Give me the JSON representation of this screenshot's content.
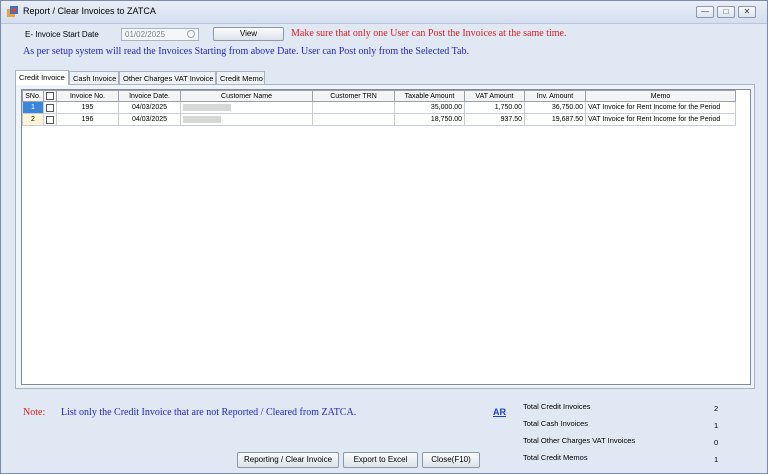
{
  "window": {
    "title": "Report / Clear Invoices to ZATCA"
  },
  "filter": {
    "start_date_label": "E- Invoice Start Date",
    "start_date_value": "01/02/2025",
    "view_label": "View"
  },
  "messages": {
    "warning": "Make sure that only one User can Post the Invoices at the same time.",
    "info": "As per setup system will read the Invoices Starting from above Date. User can Post only from the Selected Tab."
  },
  "tabs": [
    "Credit Invoice",
    "Cash Invoice",
    "Other Charges VAT Invoice",
    "Credit Memo"
  ],
  "grid": {
    "columns": [
      "SNo.",
      "",
      "Invoice No.",
      "Invoice Date.",
      "Customer Name",
      "Customer TRN",
      "Taxable Amount",
      "VAT Amount",
      "Inv. Amount",
      "Memo"
    ],
    "rows": [
      {
        "sno": "1",
        "invoice_no": "195",
        "date": "04/03/2025",
        "customer": "",
        "trn": "",
        "taxable": "35,000.00",
        "vat": "1,750.00",
        "amount": "36,750.00",
        "memo": "VAT Invoice for Rent Income for the Period"
      },
      {
        "sno": "2",
        "invoice_no": "196",
        "date": "04/03/2025",
        "customer": "",
        "trn": "",
        "taxable": "18,750.00",
        "vat": "937.50",
        "amount": "19,687.50",
        "memo": "VAT Invoice for Rent Income for the Period"
      }
    ]
  },
  "note": {
    "label": "Note:",
    "text": "List only the Credit Invoice that are not Reported / Cleared from ZATCA."
  },
  "ar_link": "AR",
  "totals": [
    {
      "label": "Total Credit Invoices",
      "value": "2"
    },
    {
      "label": "Total Cash Invoices",
      "value": "1"
    },
    {
      "label": "Total Other Charges VAT Invoices",
      "value": "0"
    },
    {
      "label": "Total Credit Memos",
      "value": "1"
    }
  ],
  "buttons": {
    "report": "Reporting / Clear Invoice",
    "excel": "Export to Excel",
    "close": "Close(F10)"
  }
}
